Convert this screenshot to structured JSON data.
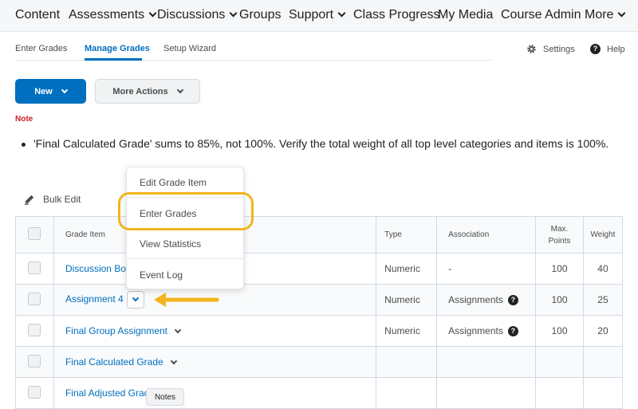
{
  "topnav": {
    "items": [
      {
        "label": "Content",
        "dropdown": false
      },
      {
        "label": "Assessments",
        "dropdown": true
      },
      {
        "label": "Discussions",
        "dropdown": true
      },
      {
        "label": "Groups",
        "dropdown": false
      },
      {
        "label": "Support",
        "dropdown": true
      },
      {
        "label": "Class Progress",
        "dropdown": false
      },
      {
        "label": "My Media",
        "dropdown": false
      },
      {
        "label": "Course Admin",
        "dropdown": false
      },
      {
        "label": "More",
        "dropdown": true
      }
    ]
  },
  "subnav": {
    "tabs": [
      "Enter Grades",
      "Manage Grades",
      "Setup Wizard"
    ],
    "active": "Manage Grades",
    "settings": "Settings",
    "help": "Help"
  },
  "toolbar": {
    "new_label": "New",
    "more_actions_label": "More Actions"
  },
  "note": {
    "title": "Note",
    "text": "'Final Calculated Grade' sums to 85%, not 100%. Verify the total weight of all top level categories and items is 100%."
  },
  "bulk_edit_label": "Bulk Edit",
  "table": {
    "headers": {
      "grade_item": "Grade Item",
      "type": "Type",
      "association": "Association",
      "max_points_1": "Max.",
      "max_points_2": "Points",
      "weight": "Weight"
    },
    "rows": [
      {
        "name": "Discussion Board",
        "visible_name": "Discussion Bo",
        "type": "Numeric",
        "association": "-",
        "max_points": "100",
        "weight": "40"
      },
      {
        "name": "Assignment 4",
        "type": "Numeric",
        "association": "Assignments",
        "max_points": "100",
        "weight": "25"
      },
      {
        "name": "Final Group Assignment",
        "type": "Numeric",
        "association": "Assignments",
        "max_points": "100",
        "weight": "20"
      },
      {
        "name": "Final Calculated Grade",
        "type": "",
        "association": "",
        "max_points": "",
        "weight": ""
      },
      {
        "name": "Final Adjusted Grade",
        "visible_name": "Final Adjusted Grade",
        "type": "",
        "association": "",
        "max_points": "",
        "weight": ""
      }
    ]
  },
  "context_menu": {
    "items": [
      "Edit Grade Item",
      "Enter Grades",
      "View Statistics",
      "Event Log"
    ],
    "highlighted": "Enter Grades"
  },
  "tooltip": "Notes",
  "colors": {
    "accent": "#006fbf",
    "note": "#cd2026",
    "highlight": "#f2b51d"
  }
}
